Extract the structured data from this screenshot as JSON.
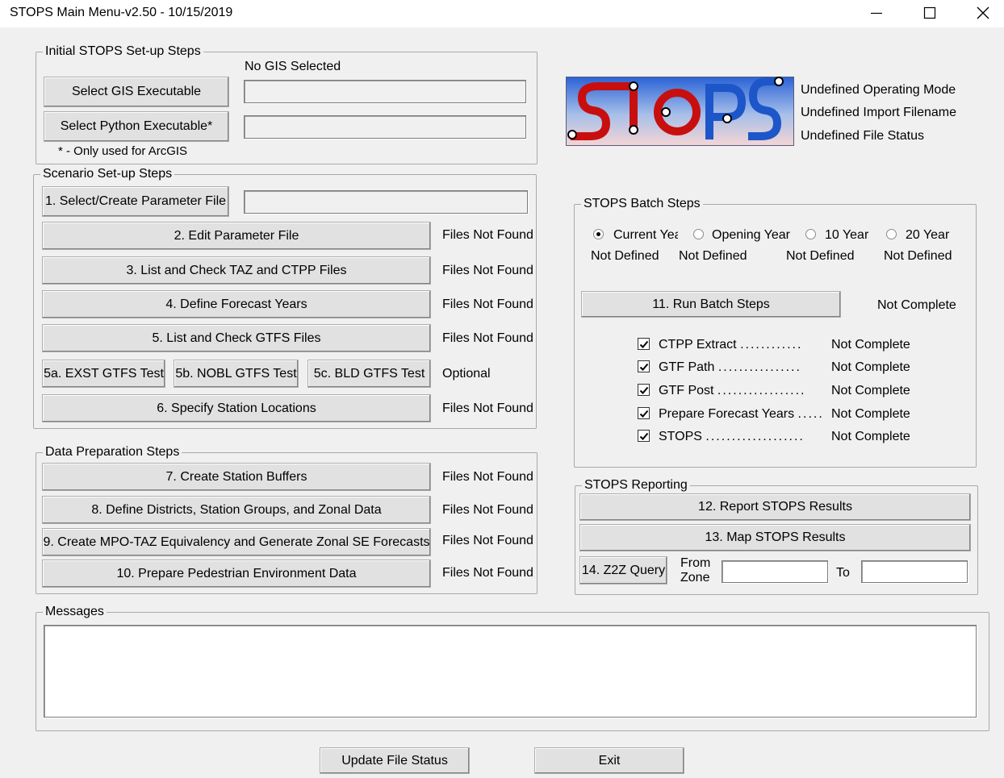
{
  "window": {
    "title": "STOPS Main Menu-v2.50 - 10/15/2019"
  },
  "initial_setup": {
    "legend": "Initial STOPS Set-up Steps",
    "gis_status": "No GIS Selected",
    "select_gis_label": "Select GIS Executable",
    "gis_path": "",
    "select_python_label": "Select Python Executable*",
    "python_path": "",
    "footnote": "* - Only used for ArcGIS"
  },
  "scenario_setup": {
    "legend": "Scenario Set-up Steps",
    "step1_label": "1. Select/Create Parameter File",
    "param_file_path": "",
    "step2_label": "2. Edit Parameter File",
    "step2_status": "Files Not Found",
    "step3_label": "3. List and Check TAZ and CTPP Files",
    "step3_status": "Files Not Found",
    "step4_label": "4. Define Forecast Years",
    "step4_status": "Files Not Found",
    "step5_label": "5. List and Check GTFS Files",
    "step5_status": "Files Not Found",
    "step5a_label": "5a. EXST GTFS Test",
    "step5b_label": "5b. NOBL GTFS Test",
    "step5c_label": "5c. BLD GTFS Test",
    "step5abc_status": "Optional",
    "step6_label": "6. Specify Station Locations",
    "step6_status": "Files Not Found"
  },
  "data_prep": {
    "legend": "Data Preparation Steps",
    "step7_label": "7. Create Station Buffers",
    "step7_status": "Files Not Found",
    "step8_label": "8. Define Districts, Station Groups, and Zonal Data",
    "step8_status": "Files Not Found",
    "step9_label": "9. Create MPO-TAZ Equivalency and Generate Zonal SE Forecasts",
    "step9_status": "Files Not Found",
    "step10_label": "10. Prepare Pedestrian Environment Data",
    "step10_status": "Files Not Found"
  },
  "status_panel": {
    "operating_mode": "Undefined Operating Mode",
    "import_filename": "Undefined Import Filename",
    "file_status": "Undefined File Status"
  },
  "batch": {
    "legend": "STOPS Batch Steps",
    "years": [
      {
        "label": "Current Yea",
        "status": "Not Defined",
        "selected": true
      },
      {
        "label": "Opening Year",
        "status": "Not Defined",
        "selected": false
      },
      {
        "label": "10 Year",
        "status": "Not Defined",
        "selected": false
      },
      {
        "label": "20 Year",
        "status": "Not Defined",
        "selected": false
      }
    ],
    "run_label": "11. Run Batch Steps",
    "run_status": "Not Complete",
    "steps": [
      {
        "label": "CTPP Extract",
        "dots": "............",
        "status": "Not Complete",
        "checked": true
      },
      {
        "label": "GTF Path",
        "dots": "................",
        "status": "Not Complete",
        "checked": true
      },
      {
        "label": "GTF Post",
        "dots": ".................",
        "status": "Not Complete",
        "checked": true
      },
      {
        "label": "Prepare Forecast Years",
        "dots": ".....",
        "status": "Not Complete",
        "checked": true
      },
      {
        "label": "STOPS",
        "dots": "...................",
        "status": "Not Complete",
        "checked": true
      }
    ]
  },
  "reporting": {
    "legend": "STOPS Reporting",
    "report_label": "12. Report STOPS Results",
    "map_label": "13. Map STOPS Results",
    "z2z_label": "14. Z2Z Query",
    "from_line1": "From",
    "from_line2": "Zone",
    "from_value": "",
    "to_label": "To",
    "to_value": ""
  },
  "messages": {
    "legend": "Messages",
    "text": ""
  },
  "footer": {
    "update_label": "Update File Status",
    "exit_label": "Exit"
  },
  "icons": [
    "minimize-icon",
    "maximize-icon",
    "close-icon",
    "check-icon",
    "stops-logo"
  ],
  "colors": {
    "logo_blue": "#1d56c8",
    "logo_red": "#c80f0f",
    "logo_bg_top": "#2a62d6",
    "logo_bg_bottom": "#f4d5d5"
  }
}
